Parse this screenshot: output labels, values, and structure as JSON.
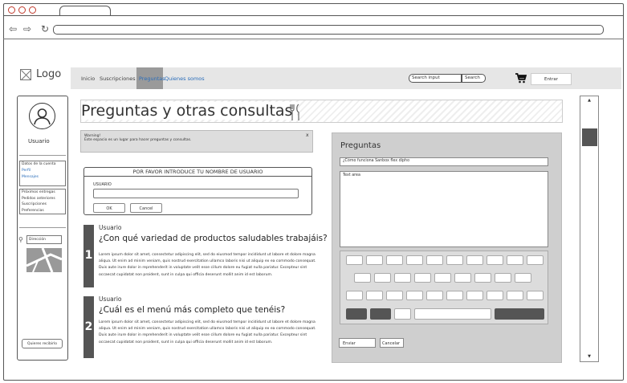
{
  "header": {
    "logo_text": "Logo",
    "nav_items": [
      "Inicio",
      "Suscripciones",
      "Preguntas",
      "Quienes somos"
    ],
    "active_nav": "Preguntas",
    "search_placeholder": "Search input",
    "search_button": "Search",
    "login_button": "Entrar"
  },
  "sidebar": {
    "user_label": "Usuario",
    "menu_group_1": [
      "Datos de la cuenta",
      "Perfil",
      "Mensajes"
    ],
    "menu_group_2": [
      "Próximos entregas",
      "Pedidos anteriores",
      "Suscripciones",
      "Preferencias"
    ],
    "location_value": "Dirección",
    "contact_button": "Quieres recibirlo"
  },
  "main": {
    "page_title": "Preguntas y otras consultas",
    "warning_title": "Warning!",
    "warning_text": "Este espacio es un lugar para hacer preguntas y consultas.",
    "warning_close": "x",
    "dialog": {
      "title": "POR FAVOR INTRODUCE TU NOMBRE DE USUARIO",
      "label": "USUARIO",
      "ok": "OK",
      "cancel": "Cancel"
    },
    "questions": [
      {
        "number": "1",
        "user": "Usuario",
        "title": "¿Con qué variedad de productos saludables trabajáis?",
        "body": "Lorem ipsum dolor sit amet, consectetur adipiscing elit, sed do eiusmod tempor incididunt ut labore et dolore magna aliqua. Ut enim ad minim veniam, quis nostrud exercitation ullamco laboris nisi ut aliquip ex ea commodo consequat. Duis aute irure dolor in reprehenderit in voluptate velit esse cillum dolore eu fugiat nulla pariatur. Excepteur sint occaecat cupidatat non proident, sunt in culpa qui officia deserunt mollit anim id est laborum."
      },
      {
        "number": "2",
        "user": "Usuario",
        "title": "¿Cuál es el menú más completo que tenéis?",
        "body": "Lorem ipsum dolor sit amet, consectetur adipiscing elit, sed do eiusmod tempor incididunt ut labore et dolore magna aliqua. Ut enim ad minim veniam, quis nostrud exercitation ullamco laboris nisi ut aliquip ex ea commodo consequat. Duis aute irure dolor in reprehenderit in voluptate velit esse cillum dolore eu fugiat nulla pariatur. Excepteur sint occaecat cupidatat non proident, sunt in culpa qui officia deserunt mollit anim id est laborum."
      }
    ]
  },
  "question_form": {
    "title": "Preguntas",
    "subject_value": "¿Cómo funciona Sanbox flex dipho",
    "message_placeholder": "Text area",
    "send_button": "Enviar",
    "clear_button": "Cancelar"
  },
  "colors": {
    "accent_link": "#2a6dba",
    "close_dot": "#c0392b",
    "dark_block": "#555555"
  }
}
